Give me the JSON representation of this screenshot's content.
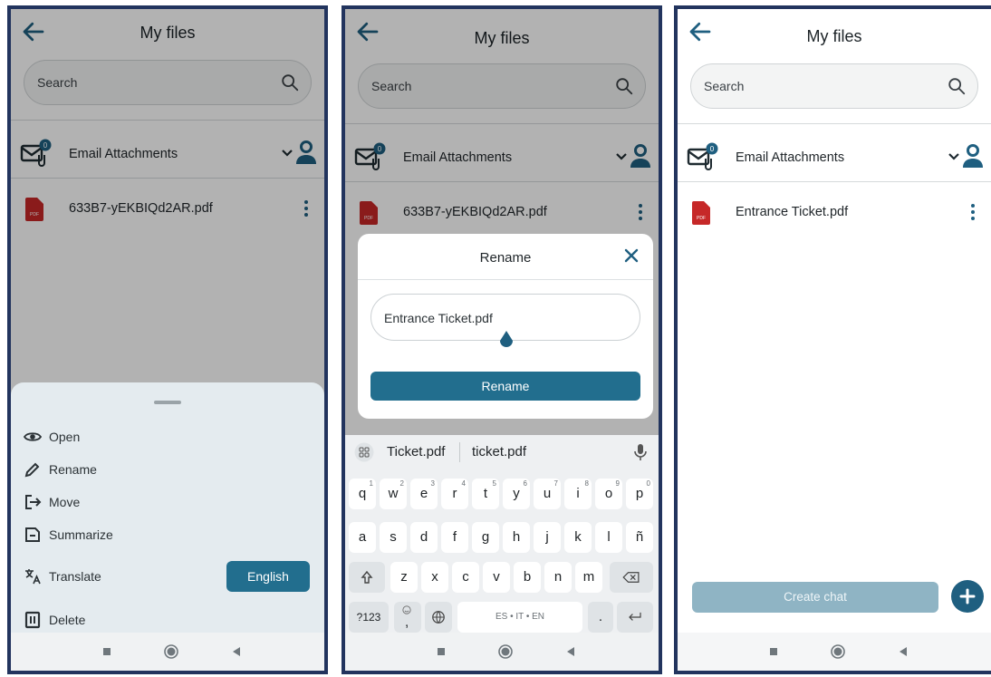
{
  "screens": [
    {
      "title": "My files",
      "search_placeholder": "Search",
      "folder": "Email Attachments",
      "folder_badge": "0",
      "file": "633B7-yEKBIQd2AR.pdf",
      "pdf_label": "PDF",
      "sheet_menu": {
        "open": "Open",
        "rename": "Rename",
        "move": "Move",
        "summarize": "Summarize",
        "translate": "Translate",
        "translate_language": "English",
        "delete": "Delete"
      }
    },
    {
      "title": "My files",
      "search_placeholder": "Search",
      "folder": "Email Attachments",
      "folder_badge": "0",
      "file": "633B7-yEKBIQd2AR.pdf",
      "pdf_label": "PDF",
      "dialog": {
        "title": "Rename",
        "input_value": "Entrance Ticket.pdf",
        "button": "Rename"
      },
      "keyboard": {
        "suggestions": [
          "Ticket.pdf",
          "ticket.pdf"
        ],
        "row1": [
          "q",
          "w",
          "e",
          "r",
          "t",
          "y",
          "u",
          "i",
          "o",
          "p"
        ],
        "row1_hints": [
          "1",
          "2",
          "3",
          "4",
          "5",
          "6",
          "7",
          "8",
          "9",
          "0"
        ],
        "row2": [
          "a",
          "s",
          "d",
          "f",
          "g",
          "h",
          "j",
          "k",
          "l",
          "ñ"
        ],
        "row3": [
          "z",
          "x",
          "c",
          "v",
          "b",
          "n",
          "m"
        ],
        "symbols_key": "?123",
        "space_label": "ES • IT • EN",
        "emoji_comma": ",",
        "period": "."
      }
    },
    {
      "title": "My files",
      "search_placeholder": "Search",
      "folder": "Email Attachments",
      "folder_badge": "0",
      "file": "Entrance Ticket.pdf",
      "pdf_label": "PDF",
      "create_chat": "Create chat"
    }
  ],
  "colors": {
    "accent": "#226e8e",
    "icon_blue": "#1f5f80",
    "pdf_red": "#c62828",
    "create_chat_disabled": "#8fb4c4",
    "sheet_bg": "#e4ebef",
    "frame": "#22345e"
  },
  "icons": {
    "back": "arrow-left-icon",
    "search": "search-icon",
    "folder": "mail-attachment-icon",
    "person": "person-icon",
    "pdf": "pdf-file-icon",
    "more": "kebab-icon",
    "close": "close-icon",
    "fab": "plus-icon"
  }
}
